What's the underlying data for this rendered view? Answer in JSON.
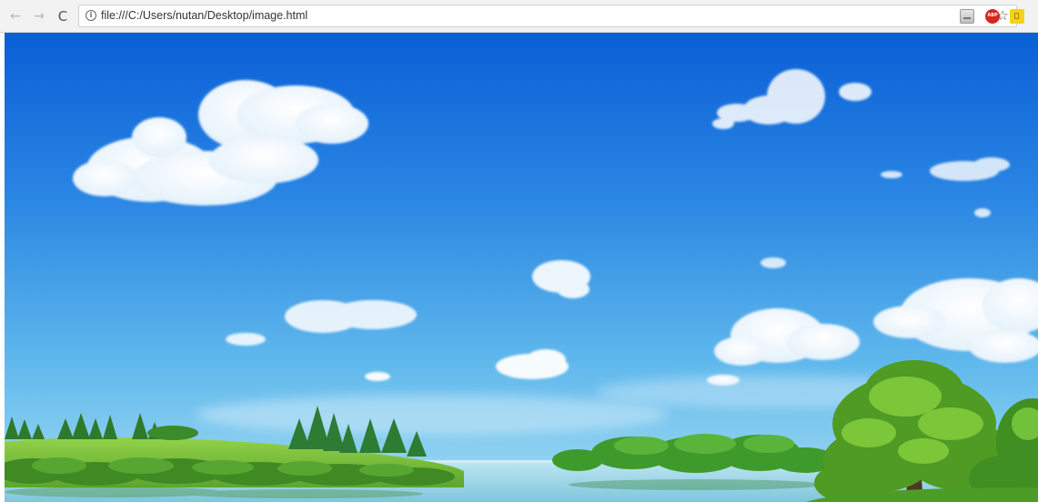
{
  "browser": {
    "url": "file:///C:/Users/nutan/Desktop/image.html",
    "nav": {
      "back_glyph": "←",
      "forward_glyph": "→",
      "reload_glyph": "C"
    },
    "icons": {
      "info": "info-icon",
      "bookmark": "star-icon",
      "extension_one": "image-extension-icon",
      "extension_two": "adblock-icon",
      "extension_three": "yellow-extension-icon"
    },
    "colors": {
      "toolbar": "#f2f2f2",
      "adblock": "#d8261d",
      "yellow_ext": "#f5d21a"
    }
  },
  "page": {
    "content": "landscape-image",
    "colors": {
      "sky_top": "#0a5fd6",
      "sky_bottom": "#8fd6f0",
      "grass": "#79c23a",
      "water": "#9fd5e6"
    }
  }
}
